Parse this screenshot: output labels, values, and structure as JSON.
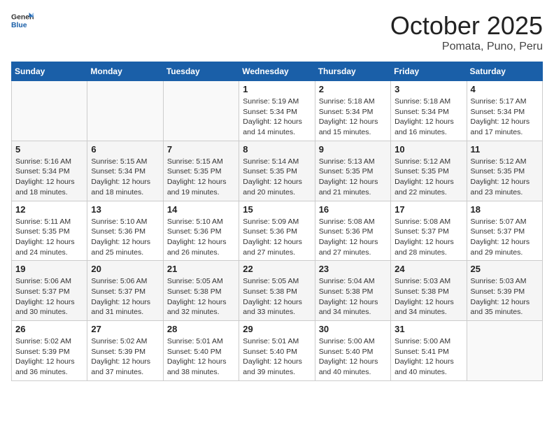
{
  "logo": {
    "line1": "General",
    "line2": "Blue"
  },
  "title": "October 2025",
  "subtitle": "Pomata, Puno, Peru",
  "days_header": [
    "Sunday",
    "Monday",
    "Tuesday",
    "Wednesday",
    "Thursday",
    "Friday",
    "Saturday"
  ],
  "weeks": [
    [
      {
        "day": "",
        "info": ""
      },
      {
        "day": "",
        "info": ""
      },
      {
        "day": "",
        "info": ""
      },
      {
        "day": "1",
        "info": "Sunrise: 5:19 AM\nSunset: 5:34 PM\nDaylight: 12 hours\nand 14 minutes."
      },
      {
        "day": "2",
        "info": "Sunrise: 5:18 AM\nSunset: 5:34 PM\nDaylight: 12 hours\nand 15 minutes."
      },
      {
        "day": "3",
        "info": "Sunrise: 5:18 AM\nSunset: 5:34 PM\nDaylight: 12 hours\nand 16 minutes."
      },
      {
        "day": "4",
        "info": "Sunrise: 5:17 AM\nSunset: 5:34 PM\nDaylight: 12 hours\nand 17 minutes."
      }
    ],
    [
      {
        "day": "5",
        "info": "Sunrise: 5:16 AM\nSunset: 5:34 PM\nDaylight: 12 hours\nand 18 minutes."
      },
      {
        "day": "6",
        "info": "Sunrise: 5:15 AM\nSunset: 5:34 PM\nDaylight: 12 hours\nand 18 minutes."
      },
      {
        "day": "7",
        "info": "Sunrise: 5:15 AM\nSunset: 5:35 PM\nDaylight: 12 hours\nand 19 minutes."
      },
      {
        "day": "8",
        "info": "Sunrise: 5:14 AM\nSunset: 5:35 PM\nDaylight: 12 hours\nand 20 minutes."
      },
      {
        "day": "9",
        "info": "Sunrise: 5:13 AM\nSunset: 5:35 PM\nDaylight: 12 hours\nand 21 minutes."
      },
      {
        "day": "10",
        "info": "Sunrise: 5:12 AM\nSunset: 5:35 PM\nDaylight: 12 hours\nand 22 minutes."
      },
      {
        "day": "11",
        "info": "Sunrise: 5:12 AM\nSunset: 5:35 PM\nDaylight: 12 hours\nand 23 minutes."
      }
    ],
    [
      {
        "day": "12",
        "info": "Sunrise: 5:11 AM\nSunset: 5:35 PM\nDaylight: 12 hours\nand 24 minutes."
      },
      {
        "day": "13",
        "info": "Sunrise: 5:10 AM\nSunset: 5:36 PM\nDaylight: 12 hours\nand 25 minutes."
      },
      {
        "day": "14",
        "info": "Sunrise: 5:10 AM\nSunset: 5:36 PM\nDaylight: 12 hours\nand 26 minutes."
      },
      {
        "day": "15",
        "info": "Sunrise: 5:09 AM\nSunset: 5:36 PM\nDaylight: 12 hours\nand 27 minutes."
      },
      {
        "day": "16",
        "info": "Sunrise: 5:08 AM\nSunset: 5:36 PM\nDaylight: 12 hours\nand 27 minutes."
      },
      {
        "day": "17",
        "info": "Sunrise: 5:08 AM\nSunset: 5:37 PM\nDaylight: 12 hours\nand 28 minutes."
      },
      {
        "day": "18",
        "info": "Sunrise: 5:07 AM\nSunset: 5:37 PM\nDaylight: 12 hours\nand 29 minutes."
      }
    ],
    [
      {
        "day": "19",
        "info": "Sunrise: 5:06 AM\nSunset: 5:37 PM\nDaylight: 12 hours\nand 30 minutes."
      },
      {
        "day": "20",
        "info": "Sunrise: 5:06 AM\nSunset: 5:37 PM\nDaylight: 12 hours\nand 31 minutes."
      },
      {
        "day": "21",
        "info": "Sunrise: 5:05 AM\nSunset: 5:38 PM\nDaylight: 12 hours\nand 32 minutes."
      },
      {
        "day": "22",
        "info": "Sunrise: 5:05 AM\nSunset: 5:38 PM\nDaylight: 12 hours\nand 33 minutes."
      },
      {
        "day": "23",
        "info": "Sunrise: 5:04 AM\nSunset: 5:38 PM\nDaylight: 12 hours\nand 34 minutes."
      },
      {
        "day": "24",
        "info": "Sunrise: 5:03 AM\nSunset: 5:38 PM\nDaylight: 12 hours\nand 34 minutes."
      },
      {
        "day": "25",
        "info": "Sunrise: 5:03 AM\nSunset: 5:39 PM\nDaylight: 12 hours\nand 35 minutes."
      }
    ],
    [
      {
        "day": "26",
        "info": "Sunrise: 5:02 AM\nSunset: 5:39 PM\nDaylight: 12 hours\nand 36 minutes."
      },
      {
        "day": "27",
        "info": "Sunrise: 5:02 AM\nSunset: 5:39 PM\nDaylight: 12 hours\nand 37 minutes."
      },
      {
        "day": "28",
        "info": "Sunrise: 5:01 AM\nSunset: 5:40 PM\nDaylight: 12 hours\nand 38 minutes."
      },
      {
        "day": "29",
        "info": "Sunrise: 5:01 AM\nSunset: 5:40 PM\nDaylight: 12 hours\nand 39 minutes."
      },
      {
        "day": "30",
        "info": "Sunrise: 5:00 AM\nSunset: 5:40 PM\nDaylight: 12 hours\nand 40 minutes."
      },
      {
        "day": "31",
        "info": "Sunrise: 5:00 AM\nSunset: 5:41 PM\nDaylight: 12 hours\nand 40 minutes."
      },
      {
        "day": "",
        "info": ""
      }
    ]
  ]
}
